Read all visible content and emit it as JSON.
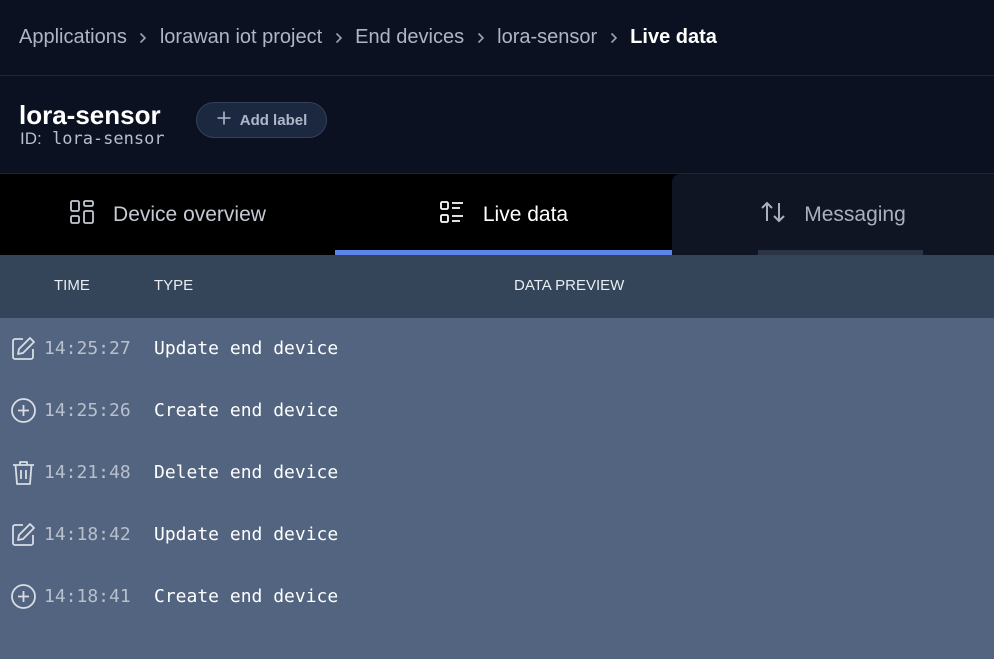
{
  "breadcrumb": [
    "Applications",
    "lorawan iot project",
    "End devices",
    "lora-sensor",
    "Live data"
  ],
  "device": {
    "name": "lora-sensor",
    "id_label": "ID:",
    "id_value": "lora-sensor",
    "add_label": "Add label"
  },
  "tabs": {
    "overview": "Device overview",
    "live": "Live data",
    "messaging": "Messaging",
    "active": "live"
  },
  "table": {
    "headers": {
      "time": "TIME",
      "type": "TYPE",
      "preview": "DATA PREVIEW"
    },
    "rows": [
      {
        "icon": "edit-icon",
        "time": "14:25:27",
        "type": "Update end device"
      },
      {
        "icon": "plus-circle-icon",
        "time": "14:25:26",
        "type": "Create end device"
      },
      {
        "icon": "trash-icon",
        "time": "14:21:48",
        "type": "Delete end device"
      },
      {
        "icon": "edit-icon",
        "time": "14:18:42",
        "type": "Update end device"
      },
      {
        "icon": "plus-circle-icon",
        "time": "14:18:41",
        "type": "Create end device"
      }
    ]
  },
  "colors": {
    "accent": "#5b84ea",
    "page_bg": "#0b1120",
    "table_header_bg": "#344559",
    "table_body_bg": "#52647f"
  }
}
